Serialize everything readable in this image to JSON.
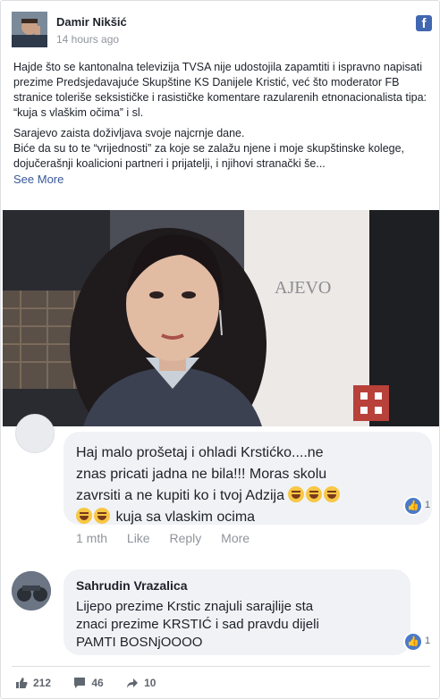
{
  "post": {
    "author": "Damir Nikšić",
    "time": "14 hours ago",
    "paragraph1": "Hajde što se kantonalna televizija TVSA nije udostojila zapamtiti i ispravno napisati prezime Predsjedavajuće Skupštine KS Danijele Kristić, već što moderator FB stranice toleriše seksističke i rasističke komentare razularenih etnonacionalista tipa: “kuja s vlaškim očima” i sl.",
    "paragraph2a": "Sarajevo zaista doživljava svoje najcrnje dane.",
    "paragraph2b": "Biće da su to te “vrijednosti” za koje se zalažu njene i moje skupštinske kolege, dojučerašnji koalicioni partneri i prijatelji, i njihovi stranački še...",
    "see_more": "See More",
    "photo_sign_text": "AJEVO"
  },
  "comments": [
    {
      "author": "",
      "text_line1": "Haj malo prošetaj i ohladi Krstićko....ne",
      "text_line2": "znas pricati jadna ne bila!!! Moras skolu",
      "text_line3": "zavrsiti a ne kupiti ko i tvoj Adzija",
      "text_line4": "kuja sa vlaskim ocima",
      "likes": "1",
      "time": "1 mth",
      "like_label": "Like",
      "reply_label": "Reply",
      "more_label": "More"
    },
    {
      "author": "Sahrudin Vrazalica",
      "text_line1": "Lijepo prezime Krstic znajuli sarajlije sta",
      "text_line2": "znaci prezime KRSTIĆ i sad pravdu dijeli",
      "text_line3": "PAMTI BOSNjOOOO",
      "likes": "1"
    }
  ],
  "footer": {
    "likes": "212",
    "comments": "46",
    "shares": "10"
  },
  "colors": {
    "facebook_blue": "#4267b2",
    "link": "#385898",
    "bubble": "#f0f2f5",
    "muted": "#90949c"
  }
}
